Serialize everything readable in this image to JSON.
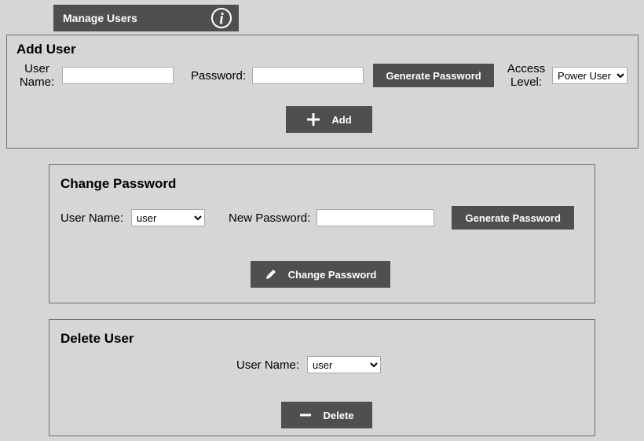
{
  "header": {
    "title": "Manage Users",
    "info_icon": "info"
  },
  "add_user": {
    "panel_title": "Add User",
    "username_label": "User Name:",
    "username_value": "",
    "password_label": "Password:",
    "password_value": "",
    "generate_label": "Generate Password",
    "access_label": "Access Level:",
    "access_options": [
      "Power User"
    ],
    "access_selected": "Power User",
    "add_button_label": "Add"
  },
  "change_password": {
    "panel_title": "Change Password",
    "username_label": "User Name:",
    "username_options": [
      "user"
    ],
    "username_selected": "user",
    "new_password_label": "New Password:",
    "new_password_value": "",
    "generate_label": "Generate Password",
    "change_button_label": "Change Password"
  },
  "delete_user": {
    "panel_title": "Delete User",
    "username_label": "User Name:",
    "username_options": [
      "user"
    ],
    "username_selected": "user",
    "delete_button_label": "Delete"
  }
}
